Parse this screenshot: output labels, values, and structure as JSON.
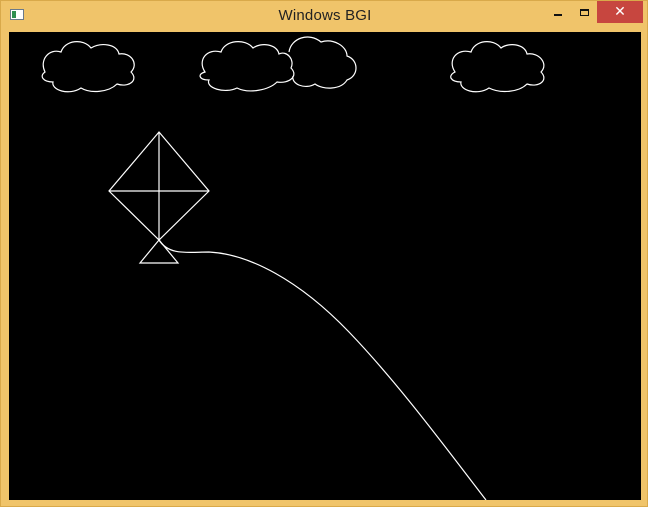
{
  "window": {
    "title": "Windows BGI",
    "controls": {
      "minimize": "minimize-icon",
      "maximize": "maximize-icon",
      "close": "close-icon"
    },
    "colors": {
      "frame": "#f0c46a",
      "close_button": "#c7463f",
      "canvas_background": "#000000",
      "stroke": "#ffffff"
    }
  },
  "canvas": {
    "shapes": [
      "cloud",
      "cloud",
      "cloud",
      "kite",
      "kite-string"
    ]
  }
}
